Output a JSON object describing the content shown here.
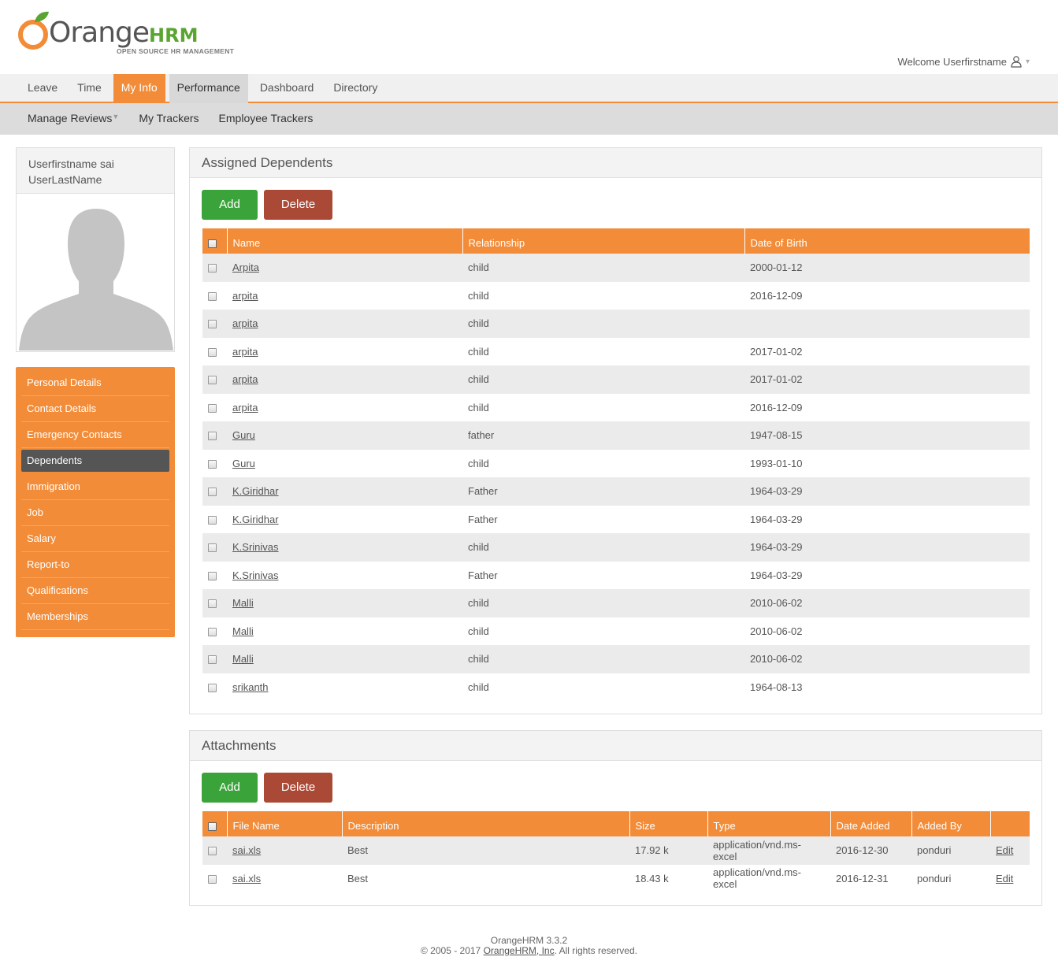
{
  "brand": {
    "wordmark": "Orange",
    "wordmark_suffix": "HRM",
    "tagline": "OPEN SOURCE HR MANAGEMENT",
    "colors": {
      "orange": "#f28c38",
      "green": "#5aa532",
      "delete_red": "#aa4935",
      "add_green": "#3aa43a"
    }
  },
  "welcome": {
    "text": "Welcome Userfirstname",
    "icon": "user-icon",
    "caret": "▾"
  },
  "main_menu": [
    {
      "label": "Leave"
    },
    {
      "label": "Time"
    },
    {
      "label": "My Info",
      "state": "active"
    },
    {
      "label": "Performance",
      "state": "hover"
    },
    {
      "label": "Dashboard"
    },
    {
      "label": "Directory"
    }
  ],
  "sub_menu": [
    {
      "label": "Manage Reviews",
      "has_dropdown": true,
      "arrow": "▼"
    },
    {
      "label": "My Trackers"
    },
    {
      "label": "Employee Trackers"
    }
  ],
  "profile": {
    "first_line": "Userfirstname sai",
    "second_line": "UserLastName"
  },
  "side_nav": [
    {
      "label": "Personal Details"
    },
    {
      "label": "Contact Details"
    },
    {
      "label": "Emergency Contacts"
    },
    {
      "label": "Dependents",
      "selected": true
    },
    {
      "label": "Immigration"
    },
    {
      "label": "Job"
    },
    {
      "label": "Salary"
    },
    {
      "label": "Report-to"
    },
    {
      "label": "Qualifications"
    },
    {
      "label": "Memberships"
    }
  ],
  "dependents": {
    "title": "Assigned Dependents",
    "add_label": "Add",
    "delete_label": "Delete",
    "columns": [
      "Name",
      "Relationship",
      "Date of Birth"
    ],
    "rows": [
      {
        "name": "Arpita",
        "relationship": "child",
        "dob": "2000-01-12"
      },
      {
        "name": "arpita",
        "relationship": "child",
        "dob": "2016-12-09"
      },
      {
        "name": "arpita",
        "relationship": "child",
        "dob": ""
      },
      {
        "name": "arpita",
        "relationship": "child",
        "dob": "2017-01-02"
      },
      {
        "name": "arpita",
        "relationship": "child",
        "dob": "2017-01-02"
      },
      {
        "name": "arpita",
        "relationship": "child",
        "dob": "2016-12-09"
      },
      {
        "name": "Guru",
        "relationship": "father",
        "dob": "1947-08-15"
      },
      {
        "name": "Guru",
        "relationship": "child",
        "dob": "1993-01-10"
      },
      {
        "name": "K.Giridhar",
        "relationship": "Father",
        "dob": "1964-03-29"
      },
      {
        "name": "K.Giridhar",
        "relationship": "Father",
        "dob": "1964-03-29"
      },
      {
        "name": "K.Srinivas",
        "relationship": "child",
        "dob": "1964-03-29"
      },
      {
        "name": "K.Srinivas",
        "relationship": "Father",
        "dob": "1964-03-29"
      },
      {
        "name": "Malli",
        "relationship": "child",
        "dob": "2010-06-02"
      },
      {
        "name": "Malli",
        "relationship": "child",
        "dob": "2010-06-02"
      },
      {
        "name": "Malli",
        "relationship": "child",
        "dob": "2010-06-02"
      },
      {
        "name": "srikanth",
        "relationship": "child",
        "dob": "1964-08-13"
      }
    ]
  },
  "attachments": {
    "title": "Attachments",
    "add_label": "Add",
    "delete_label": "Delete",
    "columns": [
      "File Name",
      "Description",
      "Size",
      "Type",
      "Date Added",
      "Added By",
      ""
    ],
    "rows": [
      {
        "file": "sai.xls",
        "description": "Best",
        "size": "17.92 k",
        "type": "application/vnd.ms-excel",
        "date": "2016-12-30",
        "added_by": "ponduri",
        "action": "Edit"
      },
      {
        "file": "sai.xls",
        "description": "Best",
        "size": "18.43 k",
        "type": "application/vnd.ms-excel",
        "date": "2016-12-31",
        "added_by": "ponduri",
        "action": "Edit"
      }
    ]
  },
  "footer": {
    "version": "OrangeHRM 3.3.2",
    "copyright_prefix": "© 2005 - 2017",
    "company_link": "OrangeHRM, Inc",
    "copyright_suffix": ". All rights reserved."
  }
}
